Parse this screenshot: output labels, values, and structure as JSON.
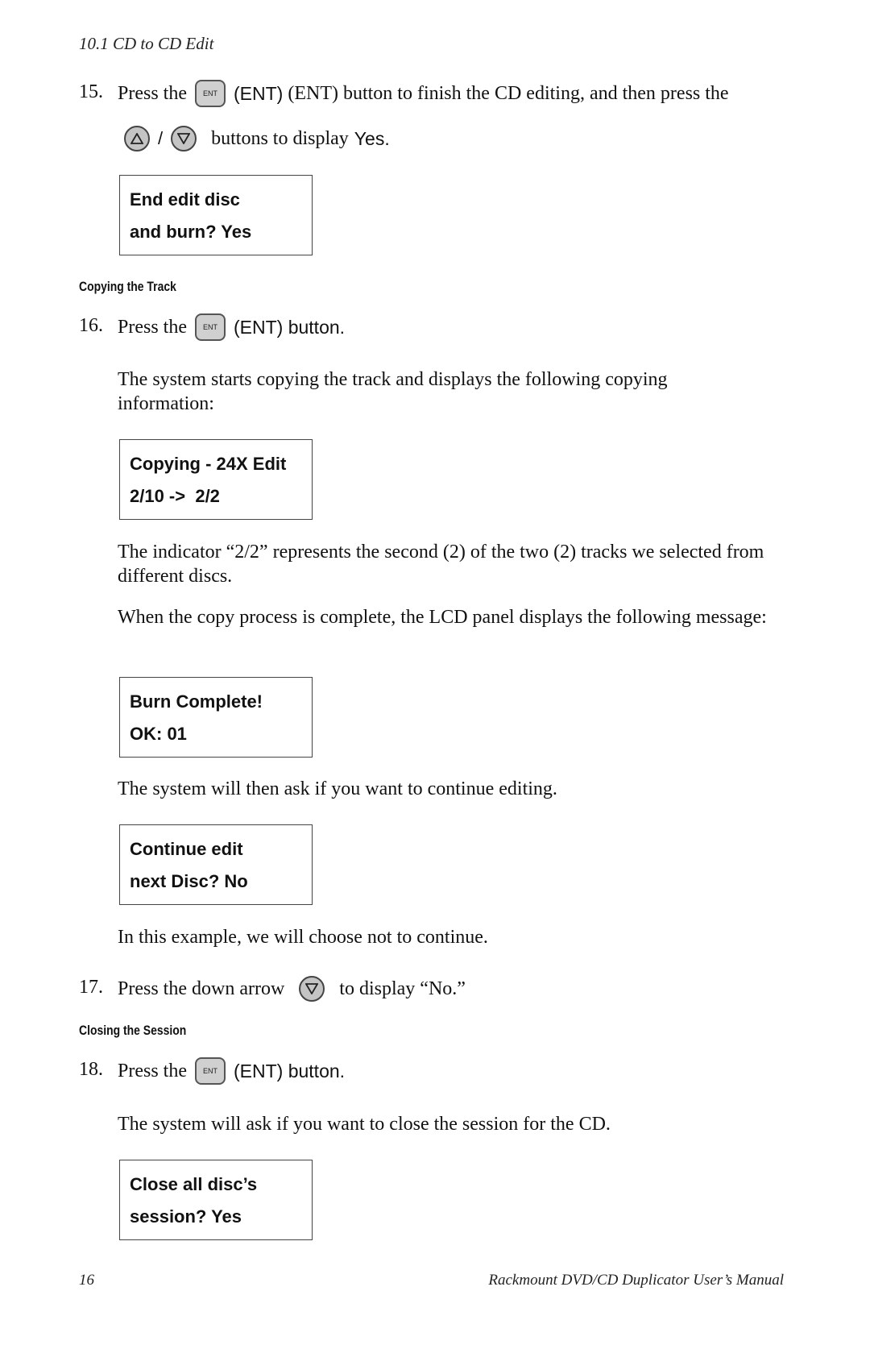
{
  "header": {
    "section": "10.1 CD to CD Edit"
  },
  "steps": {
    "s15": {
      "num": "15.",
      "pre": "Press the",
      "button": "ENT",
      "post": "(ENT) button to finish the CD editing, and then press the",
      "line2_slash": "/",
      "line2_post": "buttons to display",
      "line2_value": "Yes."
    },
    "s16": {
      "num": "16.",
      "pre": "Press the",
      "button": "ENT",
      "post": "(ENT) button."
    },
    "s17": {
      "num": "17.",
      "pre": "Press the down arrow",
      "post": "to display “No.”"
    },
    "s18": {
      "num": "18.",
      "pre": "Press the",
      "button": "ENT",
      "post": "(ENT) button."
    }
  },
  "subheads": {
    "copying": "Copying the Track",
    "closing": "Closing the Session"
  },
  "paragraphs": {
    "p_copy_start": "The system starts copying the track and displays the following copying information:",
    "p_indicator": "The indicator “2/2” represents the second (2) of the two (2) tracks we selected from different discs.",
    "p_complete": "When the copy process is complete, the LCD panel displays the following message:",
    "p_continue": "The system will then ask if you want to continue editing.",
    "p_example": "In this example, we will choose not to continue.",
    "p_close": "The system will ask if you want to close the session for the CD."
  },
  "lcd": {
    "end_edit": {
      "line1": "End edit disc",
      "line2": "and burn? Yes"
    },
    "copying": {
      "line1": "Copying - 24X Edit",
      "line2": "2/10 ->  2/2"
    },
    "complete": {
      "line1": "Burn Complete!",
      "line2": "OK: 01"
    },
    "continue": {
      "line1": "Continue edit",
      "line2": "next Disc? No"
    },
    "close": {
      "line1": "Close all disc’s",
      "line2": "session? Yes"
    }
  },
  "footer": {
    "page_number": "16",
    "manual_title": "Rackmount DVD/CD Duplicator User’s Manual"
  },
  "icons": {
    "ent": "ent-button-icon",
    "up": "up-arrow-button-icon",
    "down": "down-arrow-button-icon"
  }
}
